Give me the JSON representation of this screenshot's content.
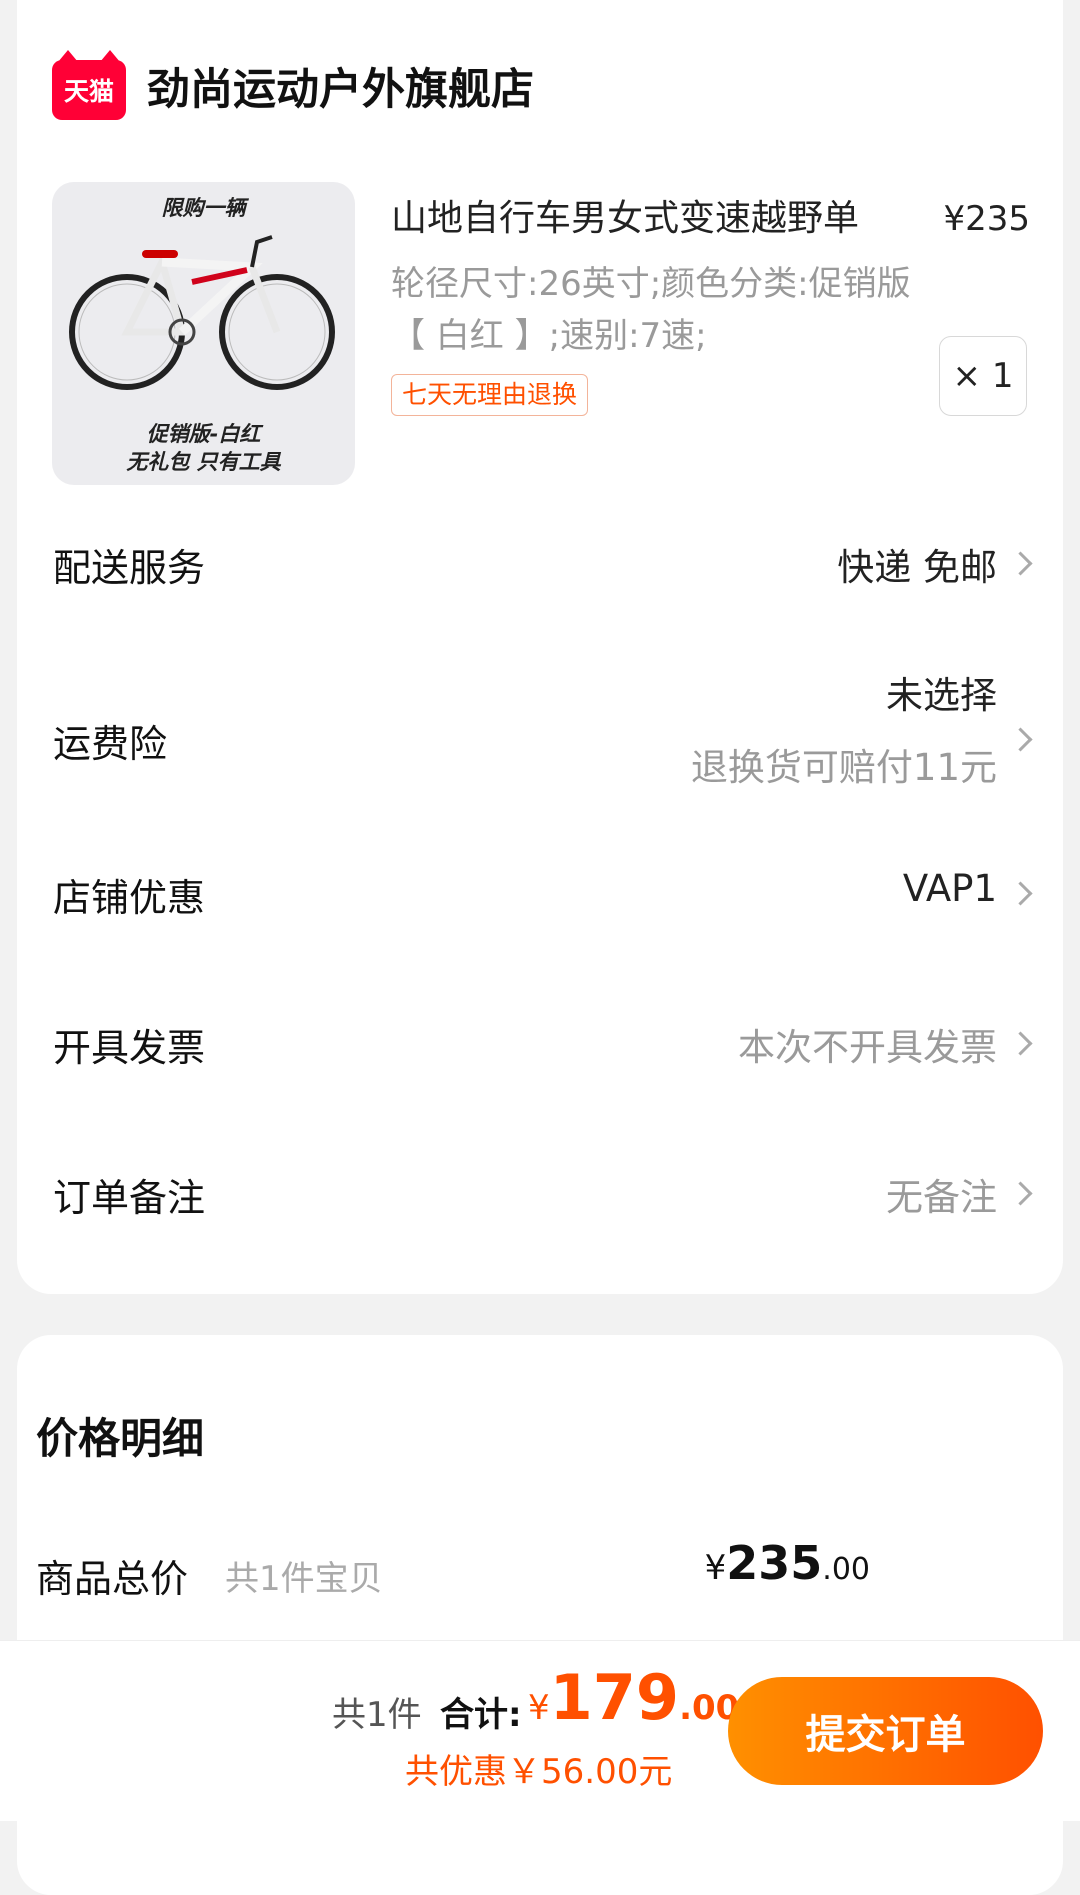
{
  "store": {
    "logo_text": "天猫",
    "name": "劲尚运动户外旗舰店"
  },
  "product": {
    "image": {
      "top_text": "限购一辆",
      "bottom_line1": "促销版-白红",
      "bottom_line2": "无礼包 只有工具"
    },
    "title": "山地自行车男女式变速越野单",
    "price": "¥235",
    "spec": "轮径尺寸:26英寸;颜色分类:促销版【 白红 】;速别:7速;",
    "badge": "七天无理由退换",
    "quantity": "× 1"
  },
  "rows": {
    "delivery": {
      "label": "配送服务",
      "value": "快递 免邮"
    },
    "insurance": {
      "label": "运费险",
      "value": "未选择",
      "sub": "退换货可赔付11元"
    },
    "discount": {
      "label": "店铺优惠",
      "value": "VAP1"
    },
    "invoice": {
      "label": "开具发票",
      "value": "本次不开具发票"
    },
    "note": {
      "label": "订单备注",
      "value": "无备注"
    }
  },
  "price_detail": {
    "title": "价格明细",
    "total_label": "商品总价",
    "total_sub": "共1件宝贝",
    "total_currency": "¥",
    "total_int": "235",
    "total_dec": ".00"
  },
  "bottom": {
    "count": "共1件",
    "total_label": "合计:",
    "currency": "¥",
    "amount_int": "179",
    "amount_dec": ".00",
    "discount": "共优惠￥56.00元",
    "submit": "提交订单"
  },
  "colors": {
    "accent": "#ff5000",
    "brand_red": "#ff0036"
  }
}
